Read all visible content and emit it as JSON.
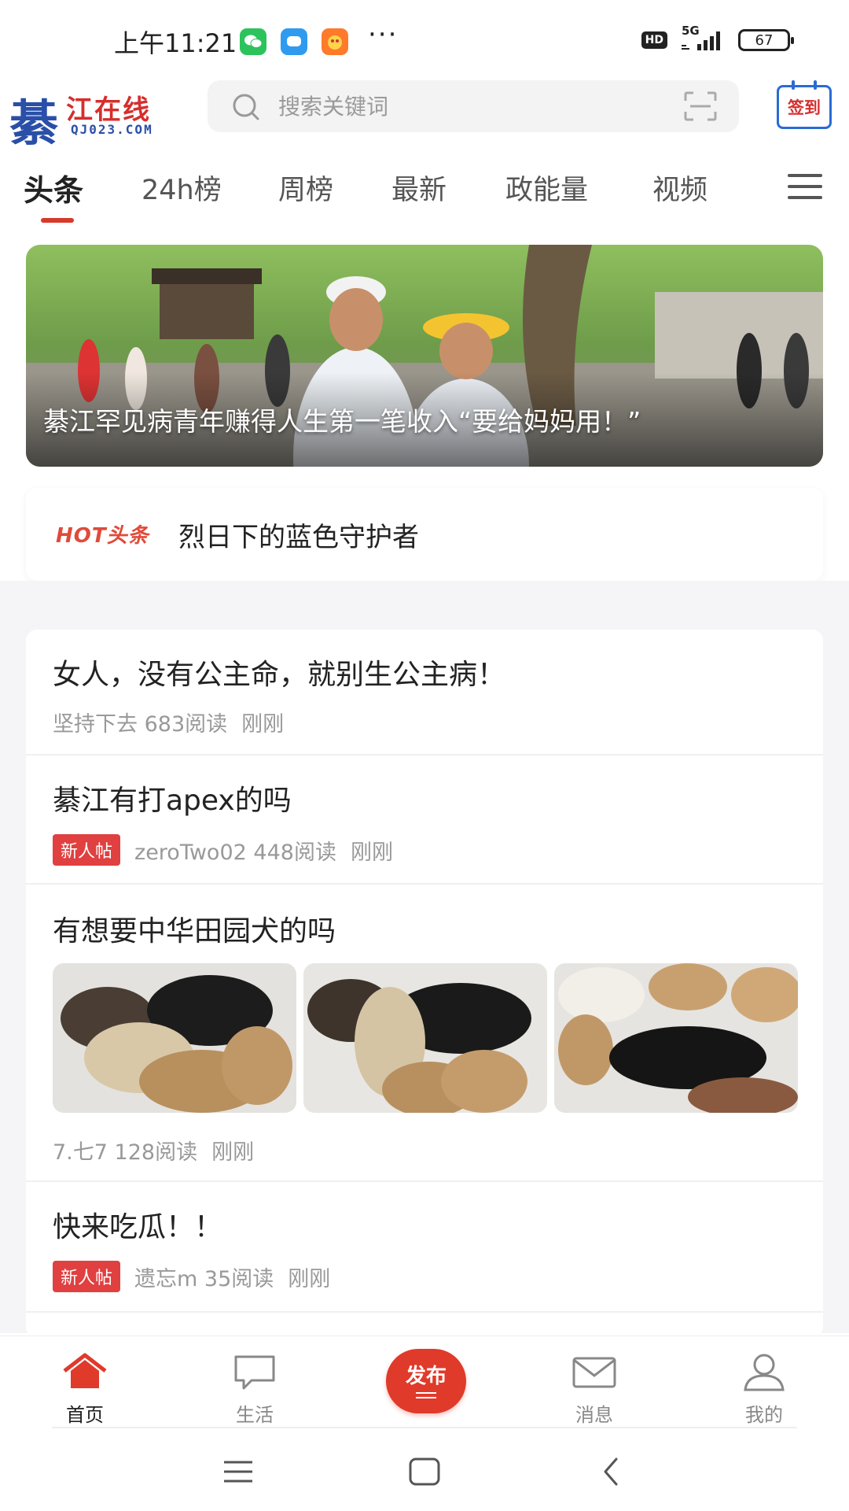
{
  "status_bar": {
    "time": "上午11:21",
    "more": "···",
    "hd": "HD",
    "network": "5G",
    "battery": "67"
  },
  "header": {
    "logo_char": "綦",
    "logo_name": "江在线",
    "logo_domain": "QJ023.COM",
    "search_placeholder": "搜索关键词",
    "checkin_label": "签到"
  },
  "tabs": [
    {
      "label": "头条",
      "active": true
    },
    {
      "label": "24h榜"
    },
    {
      "label": "周榜"
    },
    {
      "label": "最新"
    },
    {
      "label": "政能量"
    },
    {
      "label": "视频"
    }
  ],
  "banner": {
    "title": "綦江罕见病青年赚得人生第一笔收入“要给妈妈用！”"
  },
  "hot": {
    "badge": "HOT头条",
    "text": "烈日下的蓝色守护者"
  },
  "feed": [
    {
      "title": "女人，没有公主命，就别生公主病！",
      "author": "坚持下去",
      "reads": "683阅读",
      "time": "刚刚"
    },
    {
      "title": "綦江有打apex的吗",
      "tag": "新人帖",
      "author": "zeroTwo02",
      "reads": "448阅读",
      "time": "刚刚"
    },
    {
      "title": "有想要中华田园犬的吗",
      "author": "7.七7",
      "reads": "128阅读",
      "time": "刚刚"
    },
    {
      "title": "快来吃瓜！！",
      "tag": "新人帖",
      "author": "遗忘m",
      "reads": "35阅读",
      "time": "刚刚"
    }
  ],
  "bottom_nav": [
    {
      "label": "首页",
      "icon": "home-icon",
      "active": true
    },
    {
      "label": "生活",
      "icon": "chat-bubble-icon"
    },
    {
      "label": "发布",
      "icon": "publish-icon"
    },
    {
      "label": "消息",
      "icon": "mail-icon"
    },
    {
      "label": "我的",
      "icon": "user-icon"
    }
  ],
  "colors": {
    "accent": "#e03a2a",
    "logo_blue": "#2a4fa8",
    "background": "#f5f5f7"
  }
}
